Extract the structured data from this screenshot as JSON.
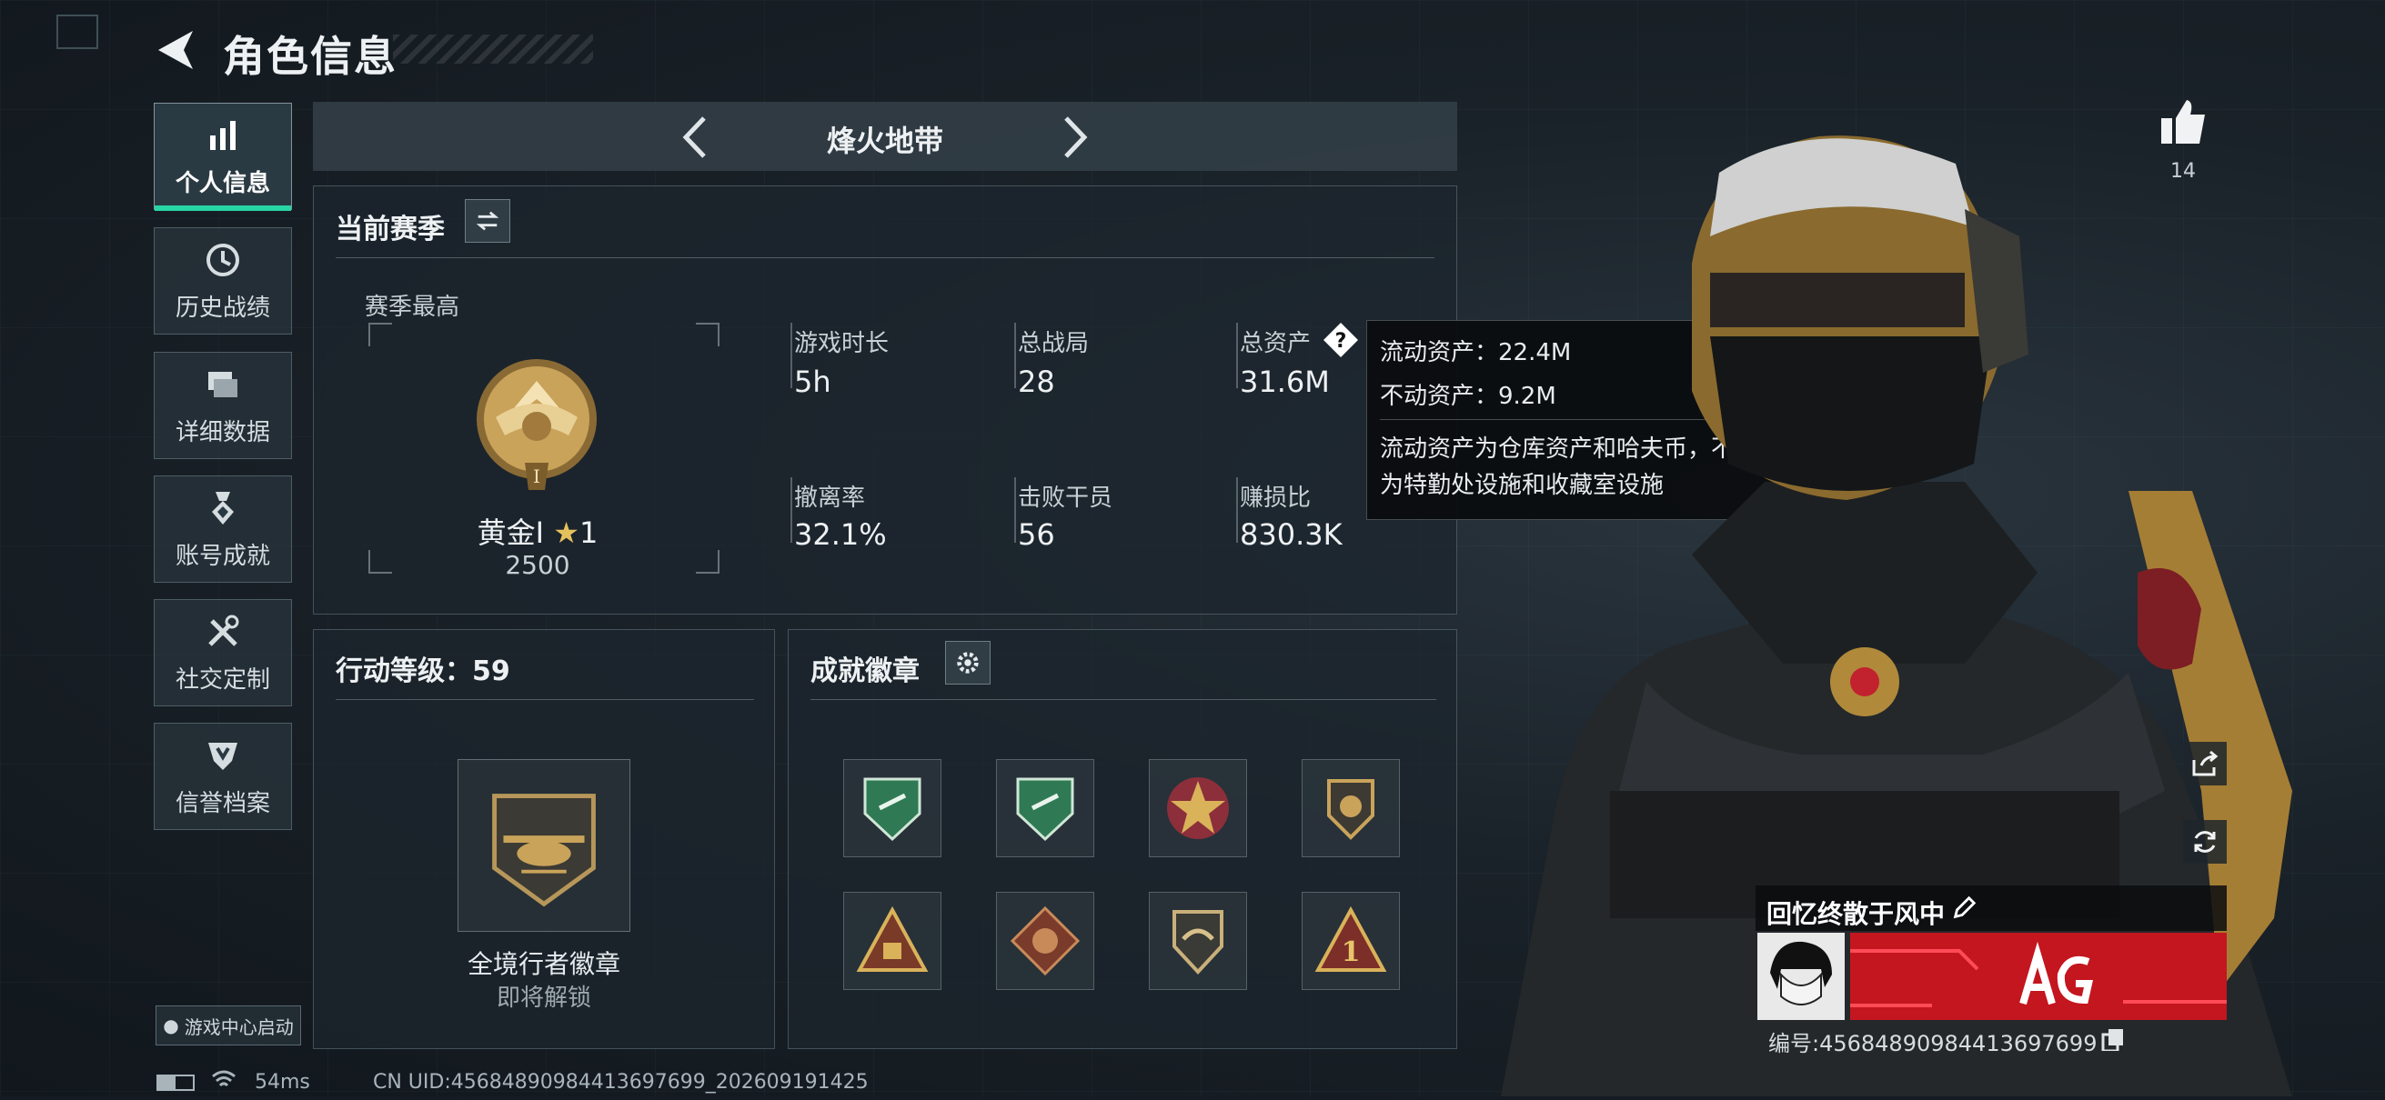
{
  "header": {
    "title": "角色信息"
  },
  "sidebar": {
    "items": [
      {
        "label": "个人信息",
        "icon": "bar-chart-icon",
        "active": true
      },
      {
        "label": "历史战绩",
        "icon": "clock-history-icon"
      },
      {
        "label": "详细数据",
        "icon": "folder-stack-icon"
      },
      {
        "label": "账号成就",
        "icon": "medal-icon"
      },
      {
        "label": "社交定制",
        "icon": "tools-icon"
      },
      {
        "label": "信誉档案",
        "icon": "shield-badge-icon"
      }
    ],
    "launch_label": "游戏中心启动"
  },
  "mode_bar": {
    "title": "烽火地带"
  },
  "season": {
    "title": "当前赛季",
    "best_label": "赛季最高",
    "rank_name": "黄金I",
    "rank_stars": "1",
    "rank_points": "2500",
    "stats": [
      {
        "label": "游戏时长",
        "value": "5h"
      },
      {
        "label": "总战局",
        "value": "28"
      },
      {
        "label": "总资产",
        "value": "31.6M"
      },
      {
        "label": "撤离率",
        "value": "32.1%"
      },
      {
        "label": "击败干员",
        "value": "56"
      },
      {
        "label": "赚损比",
        "value": "830.3K"
      }
    ]
  },
  "tooltip": {
    "liquid": "流动资产：22.4M",
    "fixed": "不动资产：9.2M",
    "desc_line1": "流动资产为仓库资产和哈夫币，不动资产",
    "desc_line2": "为特勤处设施和收藏室设施"
  },
  "action_level": {
    "title": "行动等级：59",
    "badge_name": "全境行者徽章",
    "badge_status": "即将解锁"
  },
  "achievements": {
    "title": "成就徽章",
    "badges": [
      "green-shield-badge",
      "green-shield-badge",
      "gold-star-medal",
      "gold-emblem-badge",
      "gold-triangle-badge",
      "dragon-diamond-badge",
      "eagle-shield-badge",
      "number-one-triangle-badge"
    ]
  },
  "character": {
    "likes": "14",
    "player_name": "回忆终散于风中",
    "uid_line": "编号:45684890984413697699"
  },
  "status_bar": {
    "ping": "54ms",
    "uid": "CN UID:45684890984413697699_202609191425"
  },
  "colors": {
    "accent": "#27d6a4",
    "gold": "#c9a35a",
    "banner_red": "#d21d2b"
  }
}
